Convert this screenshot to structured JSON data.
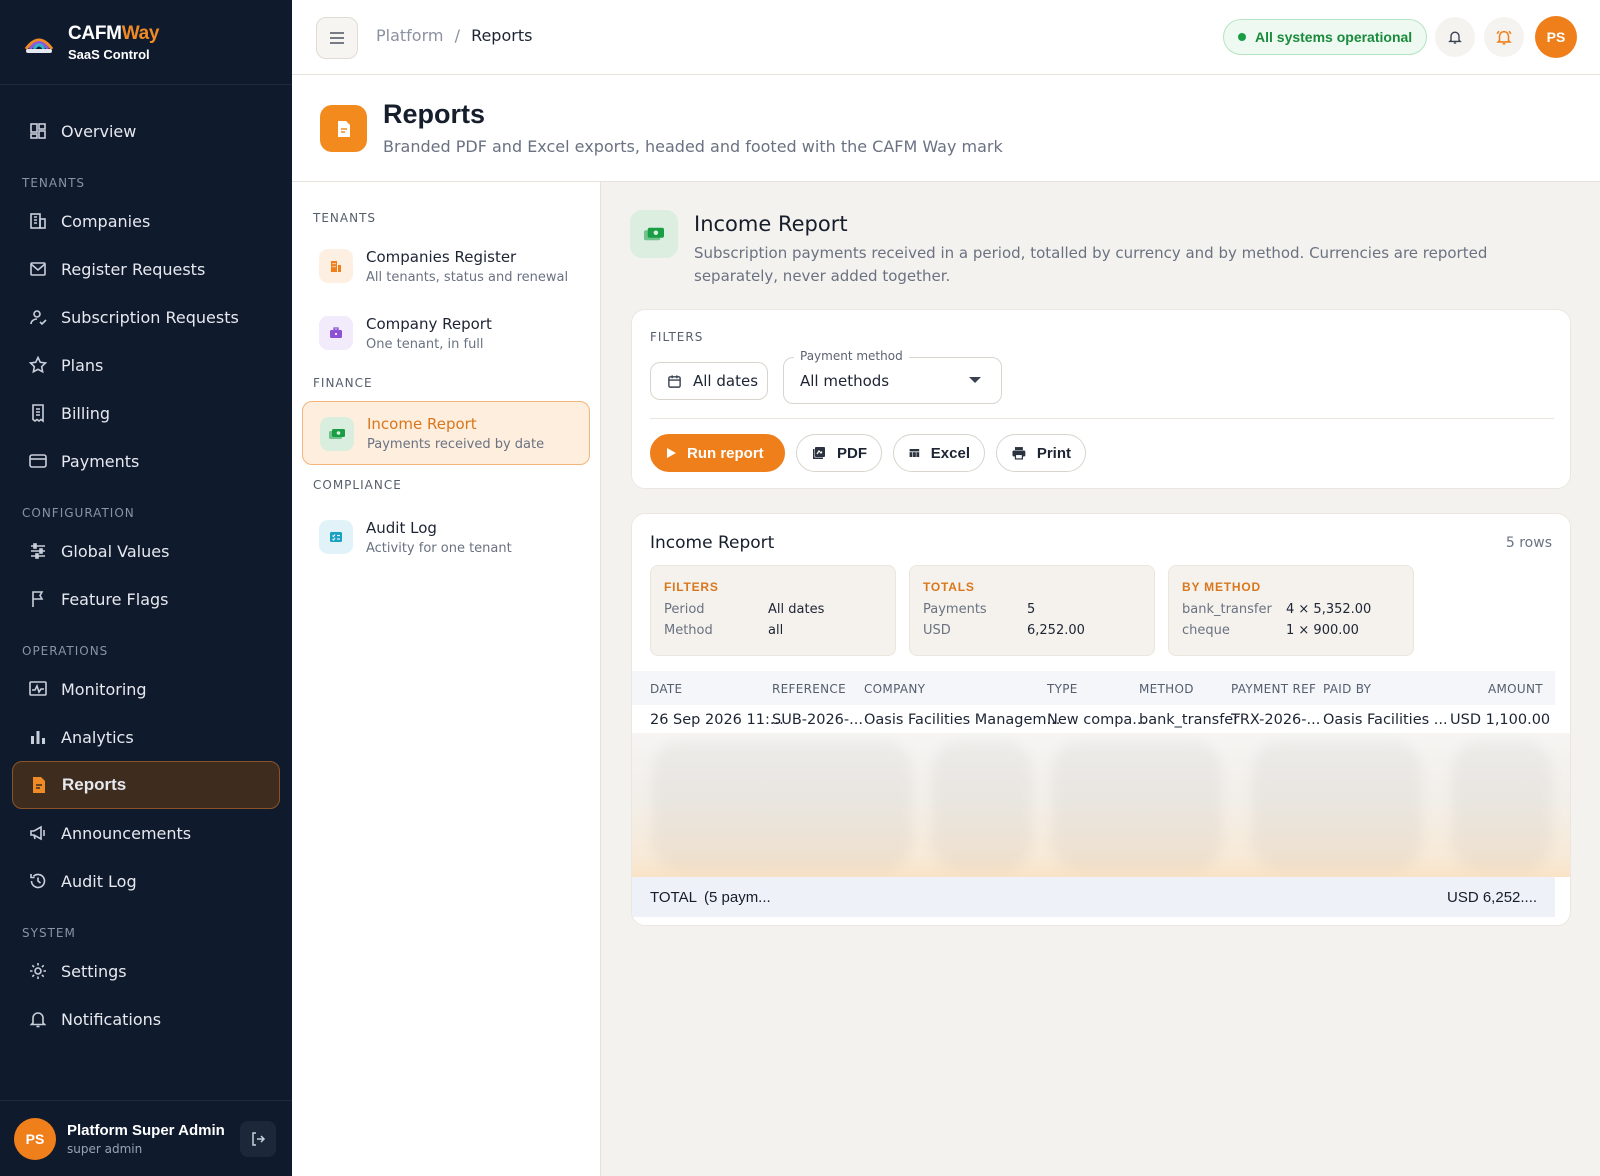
{
  "brand": {
    "name_main": "CAFM",
    "name_accent": "Way",
    "subtitle": "SaaS Control"
  },
  "nav": {
    "overview": "Overview",
    "sections": {
      "tenants": "TENANTS",
      "configuration": "CONFIGURATION",
      "operations": "OPERATIONS",
      "system": "SYSTEM"
    },
    "items": {
      "companies": "Companies",
      "register_requests": "Register Requests",
      "subscription_requests": "Subscription Requests",
      "plans": "Plans",
      "billing": "Billing",
      "payments": "Payments",
      "global_values": "Global Values",
      "feature_flags": "Feature Flags",
      "monitoring": "Monitoring",
      "analytics": "Analytics",
      "reports": "Reports",
      "announcements": "Announcements",
      "audit_log": "Audit Log",
      "settings": "Settings",
      "notifications": "Notifications"
    },
    "active": "reports"
  },
  "user": {
    "initials": "PS",
    "name": "Platform Super Admin",
    "role": "super admin"
  },
  "topbar": {
    "breadcrumb_root": "Platform",
    "breadcrumb_sep": "/",
    "breadcrumb_current": "Reports",
    "status": "All systems operational",
    "avatar_initials": "PS"
  },
  "page": {
    "title": "Reports",
    "subtitle": "Branded PDF and Excel exports, headed and footed with the CAFM Way mark"
  },
  "report_list": {
    "sections": {
      "tenants": "TENANTS",
      "finance": "FINANCE",
      "compliance": "COMPLIANCE"
    },
    "items": {
      "companies_register": {
        "title": "Companies Register",
        "subtitle": "All tenants, status and renewal"
      },
      "company_report": {
        "title": "Company Report",
        "subtitle": "One tenant, in full"
      },
      "income_report": {
        "title": "Income Report",
        "subtitle": "Payments received by date"
      },
      "audit_log": {
        "title": "Audit Log",
        "subtitle": "Activity for one tenant"
      }
    }
  },
  "report": {
    "title": "Income Report",
    "description": "Subscription payments received in a period, totalled by currency and by method. Currencies are reported separately, never added together.",
    "filters": {
      "label": "FILTERS",
      "dates": "All dates",
      "method_legend": "Payment method",
      "method_value": "All methods"
    },
    "actions": {
      "run": "Run report",
      "pdf": "PDF",
      "excel": "Excel",
      "print": "Print"
    }
  },
  "result": {
    "title": "Income Report",
    "row_count": "5 rows",
    "summary": {
      "filters": {
        "heading": "FILTERS",
        "period_label": "Period",
        "period_value": "All dates",
        "method_label": "Method",
        "method_value": "all"
      },
      "totals": {
        "heading": "TOTALS",
        "payments_label": "Payments",
        "payments_value": "5",
        "usd_label": "USD",
        "usd_value": "6,252.00"
      },
      "by_method": {
        "heading": "BY METHOD",
        "bank_label": "bank_transfer",
        "bank_value": "4 × 5,352.00",
        "cheque_label": "cheque",
        "cheque_value": "1 × 900.00"
      }
    },
    "columns": {
      "date": "DATE",
      "reference": "REFERENCE",
      "company": "COMPANY",
      "type": "TYPE",
      "method": "METHOD",
      "payment_ref": "PAYMENT REF",
      "paid_by": "PAID BY",
      "amount": "AMOUNT"
    },
    "row1": {
      "date": "26 Sep 2026 11:...",
      "reference": "SUB-2026-...",
      "company": "Oasis Facilities Managem...",
      "type": "New compa...",
      "method": "bank_transfer",
      "payment_ref": "TRX-2026-...",
      "paid_by": "Oasis Facilities ...",
      "amount": "USD 1,100.00"
    },
    "footer": {
      "label": "TOTAL",
      "count": "(5 paym...",
      "amount": "USD 6,252...."
    }
  },
  "colors": {
    "accent": "#ef7f1a",
    "sidebar_bg": "#101a2d",
    "status_green": "#1a8a3c"
  }
}
